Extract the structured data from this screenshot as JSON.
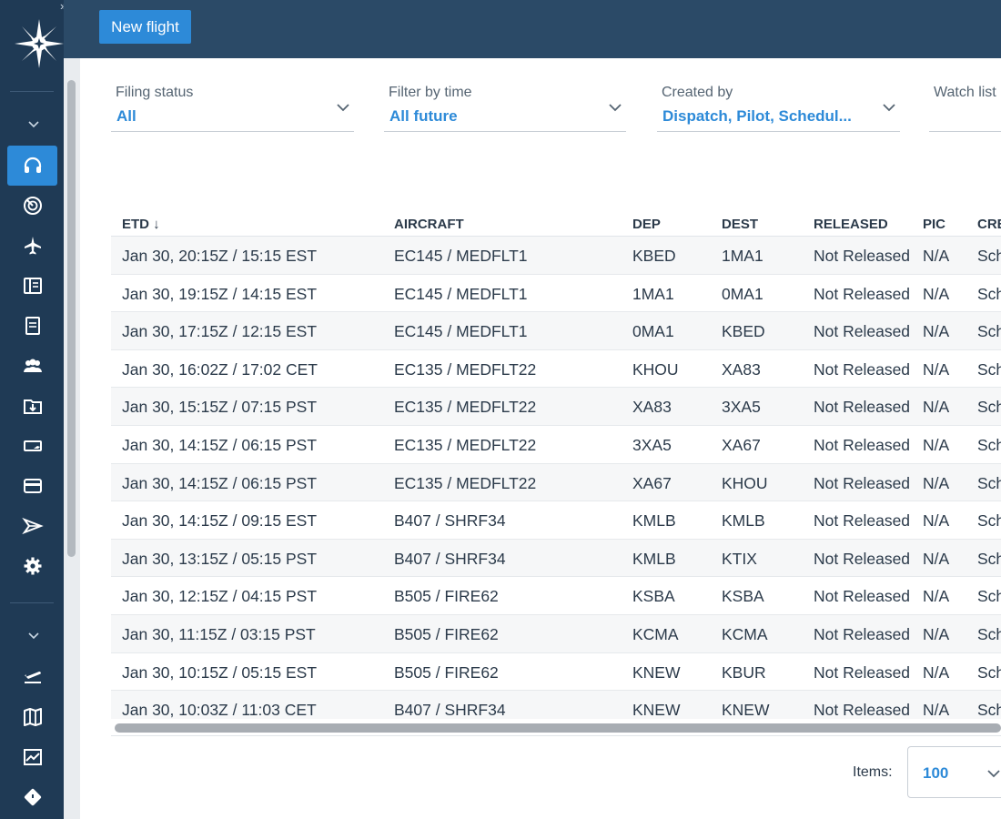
{
  "toolbar": {
    "new_flight_label": "New flight"
  },
  "sidebar": {
    "expand_glyph": "»",
    "icons": [
      "headset-icon",
      "radar-icon",
      "airplane-icon",
      "book-icon",
      "document-icon",
      "crew-icon",
      "folder-download-icon",
      "aircraft-card-icon",
      "credit-card-icon",
      "send-icon",
      "gear-icon",
      "departure-icon",
      "map-icon",
      "chart-icon",
      "tag-icon"
    ],
    "active_item": "headset-icon"
  },
  "filters": [
    {
      "label": "Filing status",
      "value": "All"
    },
    {
      "label": "Filter by time",
      "value": "All future"
    },
    {
      "label": "Created by",
      "value": "Dispatch, Pilot, Schedul..."
    },
    {
      "label": "Watch list",
      "value": ""
    }
  ],
  "table": {
    "columns": [
      "ETD ↓",
      "AIRCRAFT",
      "DEP",
      "DEST",
      "RELEASED",
      "PIC",
      "CREATED"
    ],
    "rows": [
      [
        "Jan 30, 20:15Z / 15:15 EST",
        "EC145 / MEDFLT1",
        "KBED",
        "1MA1",
        "Not Released",
        "N/A",
        "Sch"
      ],
      [
        "Jan 30, 19:15Z / 14:15 EST",
        "EC145 / MEDFLT1",
        "1MA1",
        "0MA1",
        "Not Released",
        "N/A",
        "Sch"
      ],
      [
        "Jan 30, 17:15Z / 12:15 EST",
        "EC145 / MEDFLT1",
        "0MA1",
        "KBED",
        "Not Released",
        "N/A",
        "Sch"
      ],
      [
        "Jan 30, 16:02Z / 17:02 CET",
        "EC135 / MEDFLT22",
        "KHOU",
        "XA83",
        "Not Released",
        "N/A",
        "Sch"
      ],
      [
        "Jan 30, 15:15Z / 07:15 PST",
        "EC135 / MEDFLT22",
        "XA83",
        "3XA5",
        "Not Released",
        "N/A",
        "Sch"
      ],
      [
        "Jan 30, 14:15Z / 06:15 PST",
        "EC135 / MEDFLT22",
        "3XA5",
        "XA67",
        "Not Released",
        "N/A",
        "Sch"
      ],
      [
        "Jan 30, 14:15Z / 06:15 PST",
        "EC135 / MEDFLT22",
        "XA67",
        "KHOU",
        "Not Released",
        "N/A",
        "Sch"
      ],
      [
        "Jan 30, 14:15Z / 09:15 EST",
        "B407 / SHRF34",
        "KMLB",
        "KMLB",
        "Not Released",
        "N/A",
        "Sch"
      ],
      [
        "Jan 30, 13:15Z / 05:15 PST",
        "B407 / SHRF34",
        "KMLB",
        "KTIX",
        "Not Released",
        "N/A",
        "Sch"
      ],
      [
        "Jan 30, 12:15Z / 04:15 PST",
        "B505 / FIRE62",
        "KSBA",
        "KSBA",
        "Not Released",
        "N/A",
        "Sch"
      ],
      [
        "Jan 30, 11:15Z / 03:15 PST",
        "B505 / FIRE62",
        "KCMA",
        "KCMA",
        "Not Released",
        "N/A",
        "Sch"
      ],
      [
        "Jan 30, 10:15Z / 05:15 EST",
        "B505 / FIRE62",
        "KNEW",
        "KBUR",
        "Not Released",
        "N/A",
        "Sch"
      ],
      [
        "Jan 30, 10:03Z / 11:03 CET",
        "B407 / SHRF34",
        "KNEW",
        "KNEW",
        "Not Released",
        "N/A",
        "Sch"
      ]
    ]
  },
  "pagination": {
    "items_label": "Items:",
    "items_value": "100"
  }
}
